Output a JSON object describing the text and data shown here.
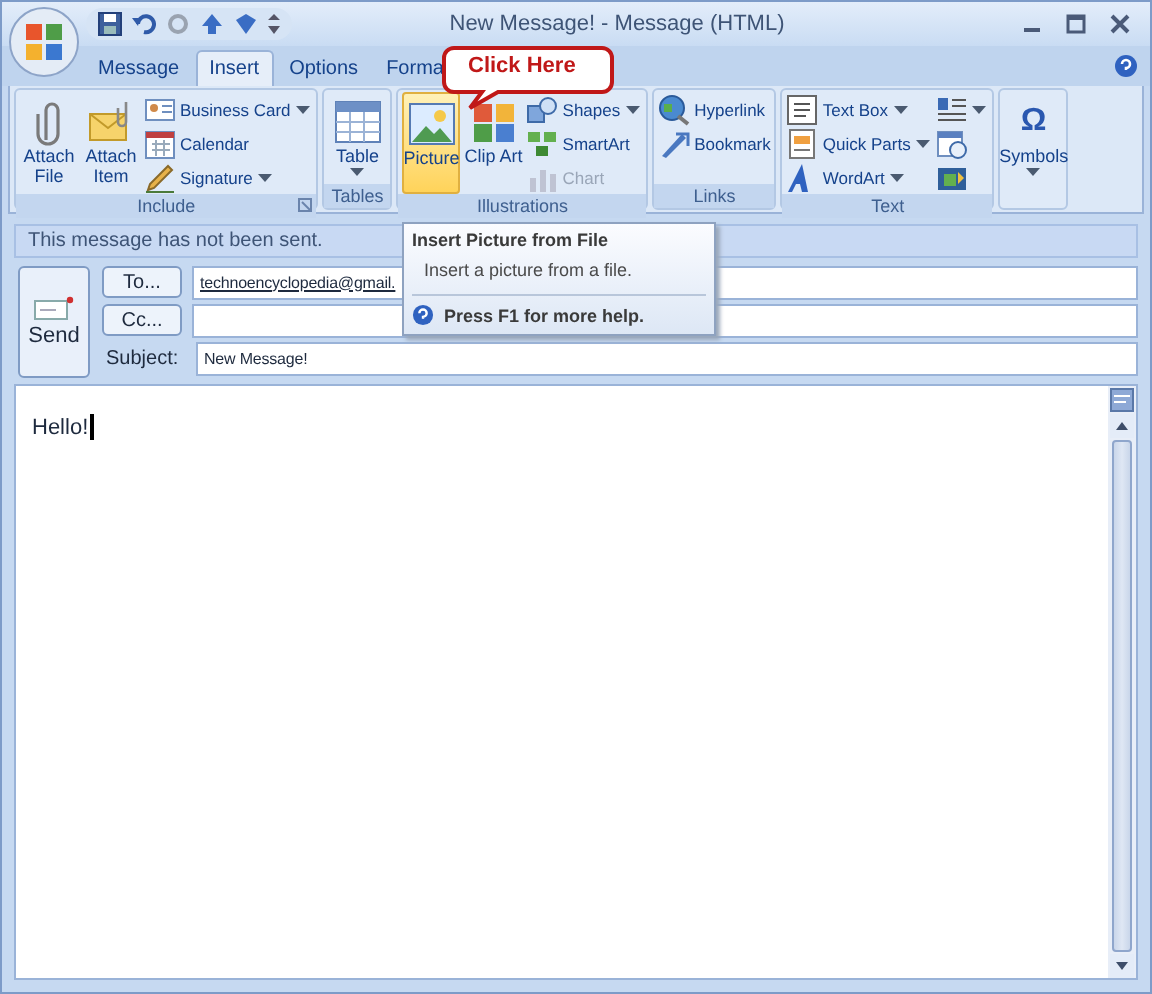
{
  "window": {
    "title": "New Message! - Message (HTML)"
  },
  "tabs": [
    {
      "label": "Message",
      "selected": false
    },
    {
      "label": "Insert",
      "selected": true
    },
    {
      "label": "Options",
      "selected": false
    },
    {
      "label": "Forma",
      "selected": false
    }
  ],
  "ribbon_groups": [
    {
      "label": "Include",
      "launcher": true,
      "items": [
        {
          "kind": "large",
          "label": "Attach File",
          "dropdown": false,
          "highlighted": false
        },
        {
          "kind": "large",
          "label": "Attach Item",
          "dropdown": false,
          "highlighted": false
        },
        {
          "kind": "stack",
          "items": [
            {
              "kind": "small",
              "label": "Business Card",
              "dropdown": true,
              "disabled": false
            },
            {
              "kind": "small",
              "label": "Calendar",
              "dropdown": false,
              "disabled": false
            },
            {
              "kind": "small",
              "label": "Signature",
              "dropdown": true,
              "disabled": false
            }
          ]
        }
      ]
    },
    {
      "label": "Tables",
      "launcher": false,
      "items": [
        {
          "kind": "large",
          "label": "Table",
          "dropdown": true,
          "highlighted": false
        }
      ]
    },
    {
      "label": "Illustrations",
      "launcher": false,
      "items": [
        {
          "kind": "large",
          "label": "Picture",
          "dropdown": false,
          "highlighted": true
        },
        {
          "kind": "large",
          "label": "Clip Art",
          "dropdown": false,
          "highlighted": false
        },
        {
          "kind": "stack",
          "items": [
            {
              "kind": "small",
              "label": "Shapes",
              "dropdown": true,
              "disabled": false
            },
            {
              "kind": "small",
              "label": "SmartArt",
              "dropdown": false,
              "disabled": false
            },
            {
              "kind": "small",
              "label": "Chart",
              "dropdown": false,
              "disabled": true
            }
          ]
        }
      ]
    },
    {
      "label": "Links",
      "launcher": false,
      "items": [
        {
          "kind": "stack",
          "items": [
            {
              "kind": "small",
              "label": "Hyperlink",
              "dropdown": false,
              "disabled": false
            },
            {
              "kind": "small",
              "label": "Bookmark",
              "dropdown": false,
              "disabled": false
            }
          ]
        }
      ]
    },
    {
      "label": "Text",
      "launcher": false,
      "items": [
        {
          "kind": "stack",
          "items": [
            {
              "kind": "small",
              "label": "Text Box",
              "dropdown": true,
              "disabled": false
            },
            {
              "kind": "small",
              "label": "Quick Parts",
              "dropdown": true,
              "disabled": false
            },
            {
              "kind": "small",
              "label": "WordArt",
              "dropdown": true,
              "disabled": false
            }
          ]
        },
        {
          "kind": "stack",
          "items": [
            {
              "kind": "icon",
              "dropdown": true,
              "disabled": false
            },
            {
              "kind": "icon",
              "dropdown": false,
              "disabled": false
            },
            {
              "kind": "icon",
              "dropdown": false,
              "disabled": false
            }
          ]
        }
      ]
    },
    {
      "items": [
        {
          "kind": "large",
          "label": "Symbols",
          "glyph": "Ω",
          "dropdown": true,
          "highlighted": false
        }
      ]
    }
  ],
  "callout": {
    "text": "Click Here"
  },
  "tooltip": {
    "title": "Insert Picture from File",
    "description": "Insert a picture from a file.",
    "help": "Press F1 for more help."
  },
  "info_bar": {
    "text": "This message has not been sent."
  },
  "header": {
    "send": "Send",
    "fields": [
      {
        "button": "To...",
        "value": "technoencyclopedia@gmail."
      },
      {
        "button": "Cc..."
      },
      {
        "label": "Subject:",
        "value": "New Message!"
      }
    ]
  },
  "body": {
    "text": "Hello!"
  }
}
